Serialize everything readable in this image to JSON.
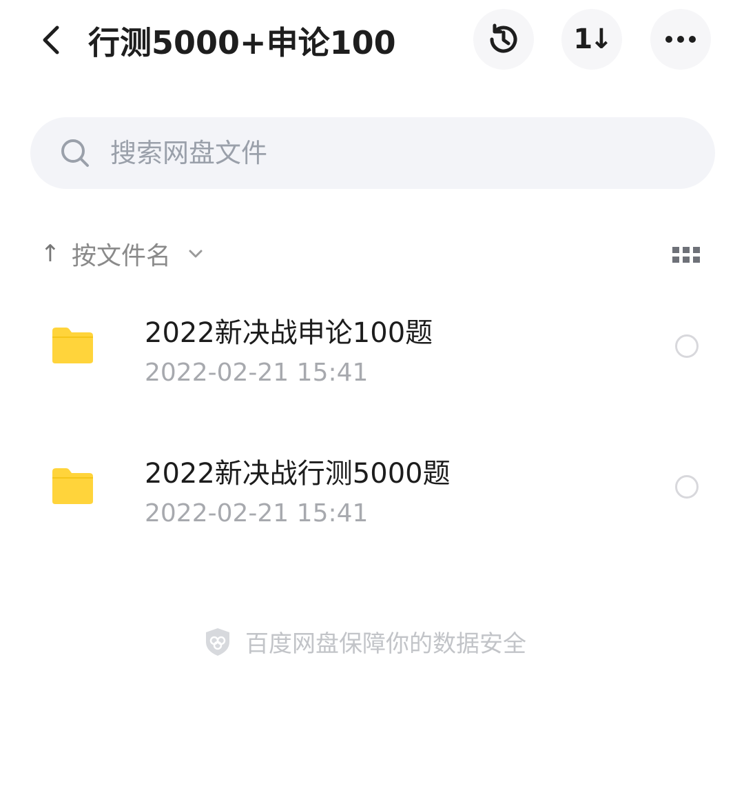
{
  "header": {
    "title": "行测5000+申论100",
    "back_icon": "chevron-left-icon",
    "actions": [
      {
        "name": "history",
        "icon": "history-icon"
      },
      {
        "name": "sort",
        "icon": "sort-icon",
        "glyph": "1↓"
      },
      {
        "name": "more",
        "icon": "more-icon"
      }
    ]
  },
  "search": {
    "placeholder": "搜索网盘文件",
    "value": ""
  },
  "sortbar": {
    "arrow": "↑",
    "label": "按文件名"
  },
  "files": [
    {
      "name": "2022新决战申论100题",
      "date": "2022-02-21  15:41",
      "type": "folder"
    },
    {
      "name": "2022新决战行测5000题",
      "date": "2022-02-21  15:41",
      "type": "folder"
    }
  ],
  "footer": {
    "text": "百度网盘保障你的数据安全",
    "icon": "shield-icon"
  },
  "colors": {
    "folder": "#FFD43B",
    "accent_text": "#1e1e1e",
    "muted": "#a7a9ae"
  }
}
